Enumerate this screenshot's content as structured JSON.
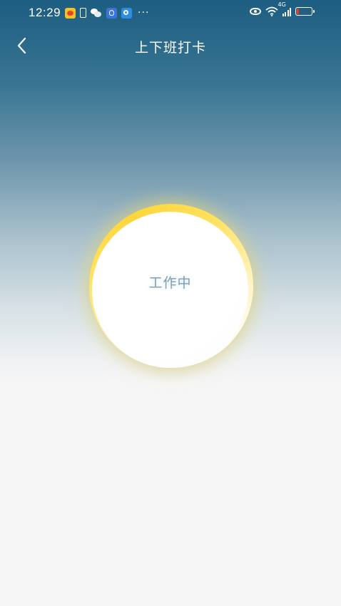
{
  "status_bar": {
    "time": "12:29",
    "more": "···",
    "network_label": "4G",
    "icons": [
      "weibo-icon",
      "phone-icon",
      "wechat-icon",
      "bulb-app-icon",
      "search-app-icon",
      "eye-icon",
      "wifi-icon",
      "signal-icon",
      "battery-icon"
    ]
  },
  "header": {
    "title": "上下班打卡",
    "back_icon": "chevron-left-icon"
  },
  "clock_button": {
    "status_label": "工作中"
  },
  "colors": {
    "header_gradient_top": "#1d5d81",
    "background": "#f6f6f6",
    "ring_yellow": "#fdd63a",
    "status_label": "#7f9fb3"
  }
}
